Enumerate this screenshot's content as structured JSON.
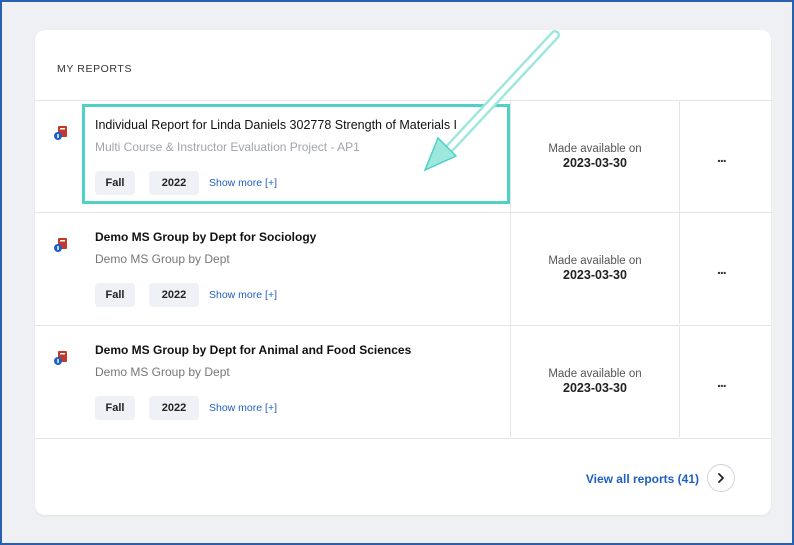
{
  "card_title": "MY REPORTS",
  "reports": [
    {
      "title": "Individual Report for Linda Daniels 302778 Strength of Materials I",
      "subtitle": "Multi Course & Instructor Evaluation Project - AP1",
      "term": "Fall",
      "year": "2022",
      "show_more": "Show more [+]",
      "available_label": "Made available on",
      "available_date": "2023-03-30",
      "menu": "..."
    },
    {
      "title": "Demo MS Group by Dept for Sociology",
      "subtitle": "Demo MS Group by Dept",
      "term": "Fall",
      "year": "2022",
      "show_more": "Show more [+]",
      "available_label": "Made available on",
      "available_date": "2023-03-30",
      "menu": "..."
    },
    {
      "title": "Demo MS Group by Dept for Animal and Food Sciences",
      "subtitle": "Demo MS Group by Dept",
      "term": "Fall",
      "year": "2022",
      "show_more": "Show more [+]",
      "available_label": "Made available on",
      "available_date": "2023-03-30",
      "menu": "..."
    }
  ],
  "footer": {
    "view_all": "View all reports (41)"
  },
  "icons": {
    "report": "report-icon",
    "next": "chevron-right-icon"
  },
  "colors": {
    "link": "#1f5fc1",
    "highlight": "#4fd1c5",
    "frame_border": "#2a5fae"
  }
}
